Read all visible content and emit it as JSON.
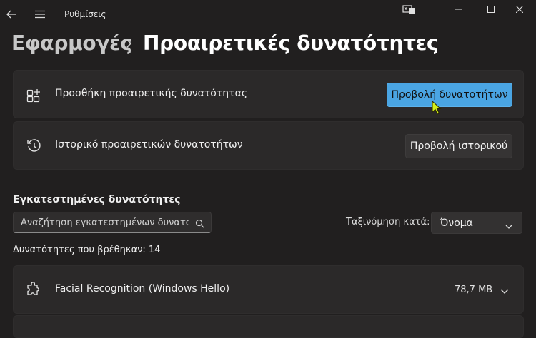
{
  "window": {
    "title": "Ρυθμίσεις"
  },
  "breadcrumb": {
    "parent": "Εφαρμογές",
    "current": "Προαιρετικές δυνατότητες"
  },
  "cards": [
    {
      "label": "Προσθήκη προαιρετικής δυνατότητας",
      "icon": "add-apps-icon",
      "button_label": "Προβολή δυνατοτήτων"
    },
    {
      "label": "Ιστορικό προαιρετικών δυνατοτήτων",
      "icon": "history-icon",
      "button_label": "Προβολή ιστορικού"
    }
  ],
  "installed": {
    "title": "Εγκατεστημένες δυνατότητες",
    "search_placeholder": "Αναζήτηση εγκατεστημένων δυνατοτ",
    "sort_label": "Ταξινόμηση κατά:",
    "sort_value": "Όνομα",
    "count_text": "Δυνατότητες που βρέθηκαν: 14",
    "items": [
      {
        "name": "Facial Recognition (Windows Hello)",
        "size": "78,7 MB",
        "icon": "puzzle-icon"
      }
    ]
  },
  "colors": {
    "accent": "#4aa5e3",
    "background": "#211f1f",
    "card": "#2b2929"
  }
}
